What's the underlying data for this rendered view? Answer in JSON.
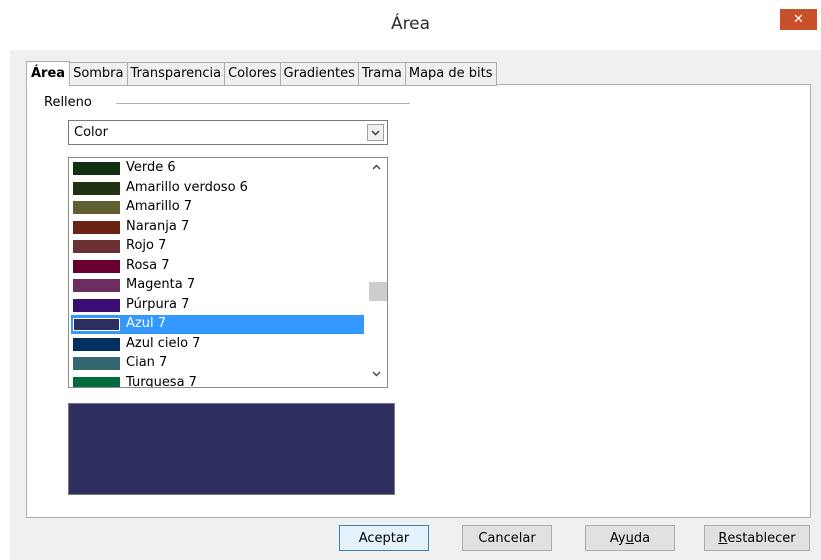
{
  "window": {
    "title": "Área",
    "close_glyph": "✕"
  },
  "tabs": [
    {
      "label": "Área",
      "active": true
    },
    {
      "label": "Sombra",
      "active": false
    },
    {
      "label": "Transparencia",
      "active": false
    },
    {
      "label": "Colores",
      "active": false
    },
    {
      "label": "Gradientes",
      "active": false
    },
    {
      "label": "Trama",
      "active": false
    },
    {
      "label": "Mapa de bits",
      "active": false
    }
  ],
  "fill": {
    "group_label": "Relleno",
    "type_select": {
      "value": "Color",
      "icon": "chevron-down-icon"
    },
    "colors": [
      {
        "name": "Verde 6",
        "color": "#103010"
      },
      {
        "name": "Amarillo verdoso 6",
        "color": "#1f3311"
      },
      {
        "name": "Amarillo 7",
        "color": "#5f5f31"
      },
      {
        "name": "Naranja 7",
        "color": "#6a2212"
      },
      {
        "name": "Rojo 7",
        "color": "#6a3034"
      },
      {
        "name": "Rosa 7",
        "color": "#67002f"
      },
      {
        "name": "Magenta 7",
        "color": "#6b2d5f"
      },
      {
        "name": "Púrpura 7",
        "color": "#3a0f75"
      },
      {
        "name": "Azul 7",
        "color": "#2d2d5f"
      },
      {
        "name": "Azul cielo 7",
        "color": "#003060"
      },
      {
        "name": "Cian 7",
        "color": "#346670"
      },
      {
        "name": "Turquesa 7",
        "color": "#006b3c"
      }
    ],
    "selected_color": "Azul 7",
    "preview_color": "#2e2e61"
  },
  "buttons": {
    "ok": "Aceptar",
    "cancel": "Cancelar",
    "help": {
      "before": "Ay",
      "mnemonic": "u",
      "after": "da"
    },
    "reset": {
      "mnemonic": "R",
      "after": "establecer"
    }
  }
}
